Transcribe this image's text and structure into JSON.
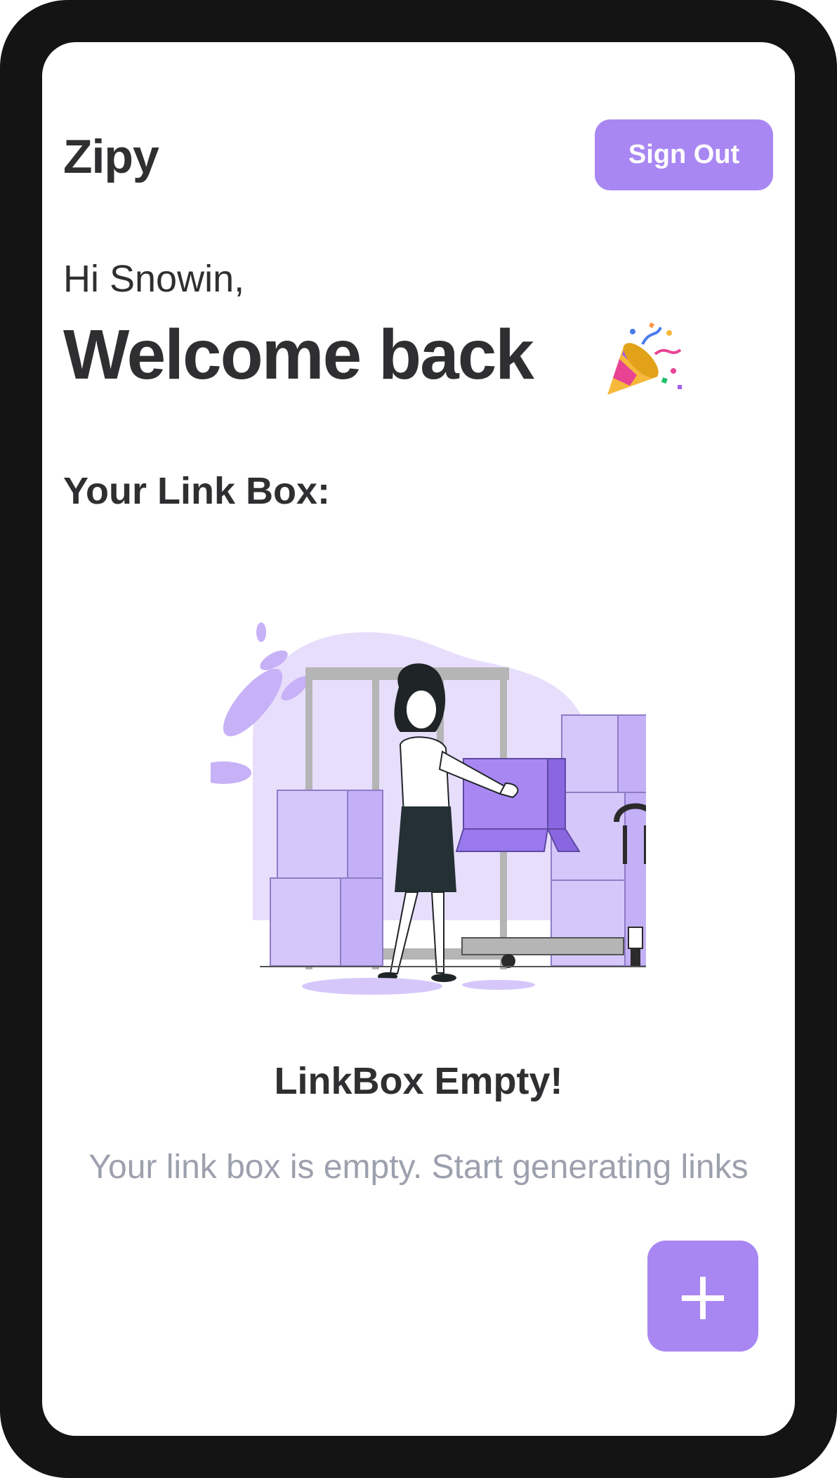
{
  "app": {
    "brand": "Zipy"
  },
  "header": {
    "sign_out_label": "Sign Out"
  },
  "greeting": {
    "hello": "Hi Snowin,",
    "welcome": "Welcome back",
    "emoji_icon": "party-popper-icon"
  },
  "linkbox": {
    "section_title": "Your Link Box:",
    "empty_title": "LinkBox Empty!",
    "empty_description": "Your link box is empty. Start generating links",
    "illustration": "woman-carrying-box-warehouse-illustration"
  },
  "fab": {
    "label": "+"
  },
  "colors": {
    "accent": "#a987f3",
    "accent_light": "#ddd0fb",
    "text_dark": "#2f2f31",
    "text_muted": "#9da0ad",
    "frame": "#141414"
  }
}
